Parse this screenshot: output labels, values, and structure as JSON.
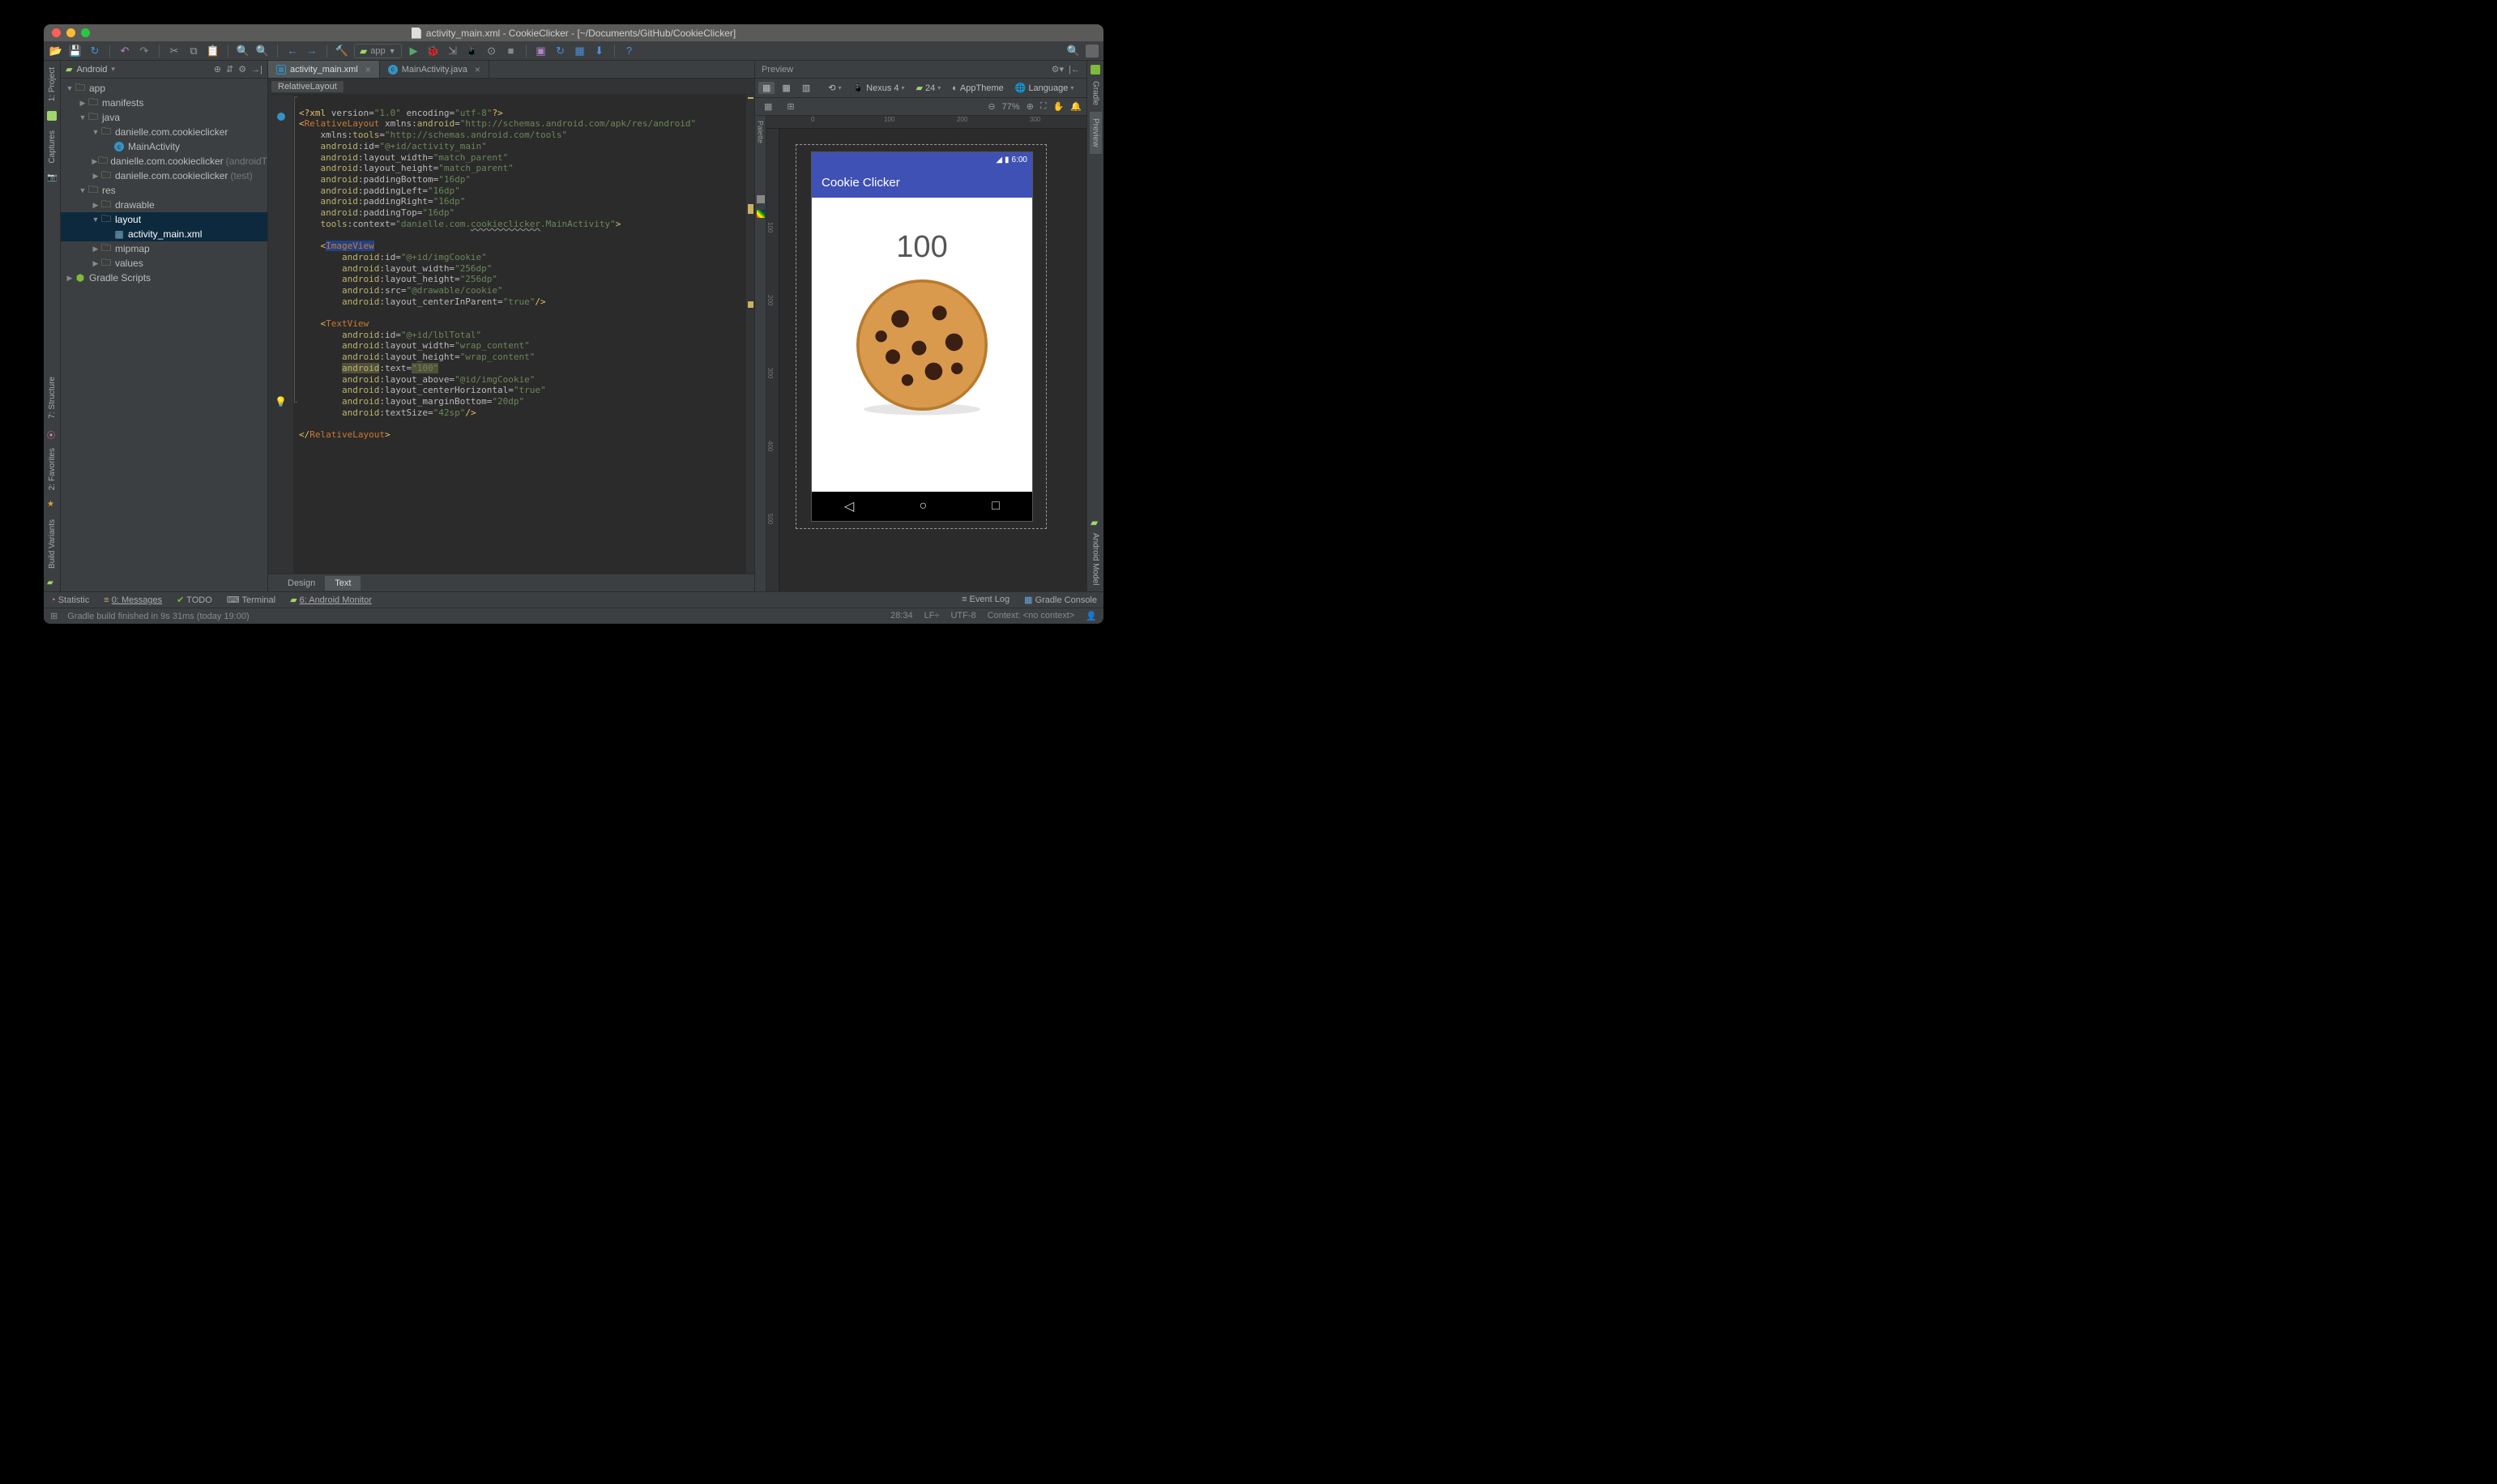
{
  "window_title": "activity_main.xml - CookieClicker - [~/Documents/GitHub/CookieClicker]",
  "toolbar": {
    "config": "app"
  },
  "project_panel": {
    "header": "Android",
    "tree": {
      "app": "app",
      "manifests": "manifests",
      "java": "java",
      "pkg1": "danielle.com.cookieclicker",
      "main_activity": "MainActivity",
      "pkg2": "danielle.com.cookieclicker",
      "pkg2_suffix": "(androidT",
      "pkg3": "danielle.com.cookieclicker",
      "pkg3_suffix": "(test)",
      "res": "res",
      "drawable": "drawable",
      "layout": "layout",
      "activity_xml": "activity_main.xml",
      "mipmap": "mipmap",
      "values": "values",
      "gradle": "Gradle Scripts"
    }
  },
  "tabs": {
    "t1": "activity_main.xml",
    "t2": "MainActivity.java"
  },
  "breadcrumb": "RelativeLayout",
  "bottom_tabs": {
    "design": "Design",
    "text": "Text"
  },
  "preview": {
    "header": "Preview",
    "toolbar": {
      "device": "Nexus 4",
      "api": "24",
      "theme": "AppTheme",
      "lang": "Language"
    },
    "zoom": "77%",
    "status_time": "6:00",
    "app_title": "Cookie Clicker",
    "counter": "100"
  },
  "ruler_h": [
    "0",
    "100",
    "200",
    "300"
  ],
  "ruler_v": [
    "100",
    "200",
    "300",
    "400",
    "500"
  ],
  "left_rail": {
    "project": "1: Project",
    "captures": "Captures",
    "structure": "7: Structure",
    "favorites": "2: Favorites",
    "build": "Build Variants"
  },
  "right_rail": {
    "gradle": "Gradle",
    "preview": "Preview",
    "model": "Android Model"
  },
  "tool_windows": {
    "statistic": "Statistic",
    "messages": "0: Messages",
    "todo": "TODO",
    "terminal": "Terminal",
    "monitor": "6: Android Monitor",
    "event_log": "Event Log",
    "gradle_console": "Gradle Console"
  },
  "status": {
    "msg": "Gradle build finished in 9s 31ms (today 19:00)",
    "pos": "28:34",
    "sep": "LF÷",
    "enc": "UTF-8",
    "ctx": "Context: <no context>"
  },
  "code": {
    "l1a": "<?xml ",
    "l1b": "version=",
    "l1c": "\"1.0\"",
    "l1d": " encoding=",
    "l1e": "\"utf-8\"",
    "l1f": "?>",
    "l2a": "<",
    "l2b": "RelativeLayout ",
    "l2c": "xmlns:",
    "l2d": "android",
    "l2e": "=",
    "l2f": "\"http://schemas.android.com/apk/res/android\"",
    "l3a": "    xmlns:",
    "l3b": "tools",
    "l3c": "=",
    "l3d": "\"http://schemas.android.com/tools\"",
    "l4a": "    ",
    "l4b": "android",
    "l4c": ":id=",
    "l4d": "\"@+id/activity_main\"",
    "l5a": "    ",
    "l5b": "android",
    "l5c": ":layout_width=",
    "l5d": "\"match_parent\"",
    "l6a": "    ",
    "l6b": "android",
    "l6c": ":layout_height=",
    "l6d": "\"match_parent\"",
    "l7a": "    ",
    "l7b": "android",
    "l7c": ":paddingBottom=",
    "l7d": "\"16dp\"",
    "l8a": "    ",
    "l8b": "android",
    "l8c": ":paddingLeft=",
    "l8d": "\"16dp\"",
    "l9a": "    ",
    "l9b": "android",
    "l9c": ":paddingRight=",
    "l9d": "\"16dp\"",
    "l10a": "    ",
    "l10b": "android",
    "l10c": ":paddingTop=",
    "l10d": "\"16dp\"",
    "l11a": "    ",
    "l11b": "tools",
    "l11c": ":context=",
    "l11d": "\"danielle.com.",
    "l11e": "cookieclicker",
    "l11f": ".MainActivity\"",
    "l11g": ">",
    "l12": "",
    "l13a": "    <",
    "l13b": "ImageView",
    "l14a": "        ",
    "l14b": "android",
    "l14c": ":id=",
    "l14d": "\"@+id/imgCookie\"",
    "l15a": "        ",
    "l15b": "android",
    "l15c": ":layout_width=",
    "l15d": "\"256dp\"",
    "l16a": "        ",
    "l16b": "android",
    "l16c": ":layout_height=",
    "l16d": "\"256dp\"",
    "l17a": "        ",
    "l17b": "android",
    "l17c": ":src=",
    "l17d": "\"@drawable/cookie\"",
    "l18a": "        ",
    "l18b": "android",
    "l18c": ":layout_centerInParent=",
    "l18d": "\"true\"",
    "l18e": "/>",
    "l19": "",
    "l20a": "    <",
    "l20b": "TextView",
    "l21a": "        ",
    "l21b": "android",
    "l21c": ":id=",
    "l21d": "\"@+id/lblTotal\"",
    "l22a": "        ",
    "l22b": "android",
    "l22c": ":layout_width=",
    "l22d": "\"wrap_content\"",
    "l23a": "        ",
    "l23b": "android",
    "l23c": ":layout_height=",
    "l23d": "\"wrap_content\"",
    "l24a": "        ",
    "l24b": "android",
    "l24c": ":text=",
    "l24d": "\"100\"",
    "l25a": "        ",
    "l25b": "android",
    "l25c": ":layout_above=",
    "l25d": "\"@id/imgCookie\"",
    "l26a": "        ",
    "l26b": "android",
    "l26c": ":layout_centerHorizontal=",
    "l26d": "\"true\"",
    "l27a": "        ",
    "l27b": "android",
    "l27c": ":layout_marginBottom=",
    "l27d": "\"20dp\"",
    "l28a": "        ",
    "l28b": "android",
    "l28c": ":textSize=",
    "l28d": "\"42sp\"",
    "l28e": "/>",
    "l29": "",
    "l30a": "</",
    "l30b": "RelativeLayout",
    "l30c": ">"
  }
}
